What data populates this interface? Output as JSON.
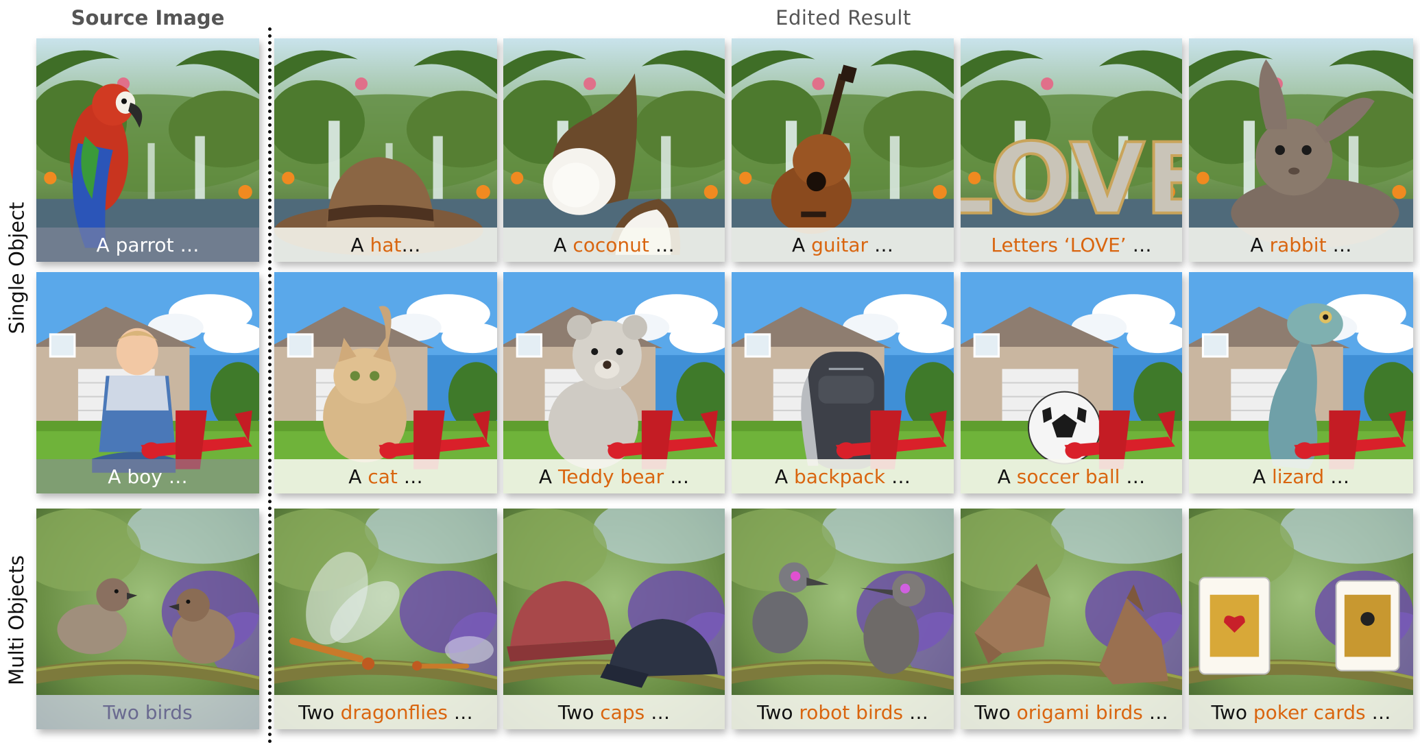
{
  "headers": {
    "source": "Source Image",
    "edited": "Edited Result"
  },
  "row_labels": {
    "single": "Single Object",
    "multi": "Multi Objects"
  },
  "rows": [
    {
      "id": "parrot",
      "source_caption": "A parrot …",
      "edits": [
        {
          "prefix": "A ",
          "object": "hat",
          "suffix": "…"
        },
        {
          "prefix": "A ",
          "object": "coconut",
          "suffix": " …"
        },
        {
          "prefix": "A ",
          "object": "guitar",
          "suffix": " …"
        },
        {
          "prefix": "",
          "object": "Letters ‘LOVE’",
          "suffix": " …"
        },
        {
          "prefix": "A ",
          "object": "rabbit",
          "suffix": " …"
        }
      ]
    },
    {
      "id": "boy",
      "source_caption": "A boy …",
      "edits": [
        {
          "prefix": "A ",
          "object": "cat",
          "suffix": " …"
        },
        {
          "prefix": "A ",
          "object": "Teddy bear",
          "suffix": " …"
        },
        {
          "prefix": "A ",
          "object": "backpack",
          "suffix": " …"
        },
        {
          "prefix": "A ",
          "object": "soccer ball",
          "suffix": " …"
        },
        {
          "prefix": "A ",
          "object": "lizard",
          "suffix": " …"
        }
      ]
    },
    {
      "id": "birds",
      "source_caption": "Two birds",
      "edits": [
        {
          "prefix": "Two ",
          "object": "dragonflies",
          "suffix": " …"
        },
        {
          "prefix": "Two ",
          "object": "caps",
          "suffix": " …"
        },
        {
          "prefix": "Two ",
          "object": "robot birds",
          "suffix": " …"
        },
        {
          "prefix": "Two ",
          "object": "origami birds",
          "suffix": " …"
        },
        {
          "prefix": "Two ",
          "object": "poker cards",
          "suffix": " …"
        }
      ]
    }
  ],
  "overlay_text": {
    "love_letters": "LOVE"
  },
  "colors": {
    "object_highlight": "#d9650f",
    "caption_text": "#111111",
    "header_text": "#555555",
    "divider": "#111111"
  }
}
